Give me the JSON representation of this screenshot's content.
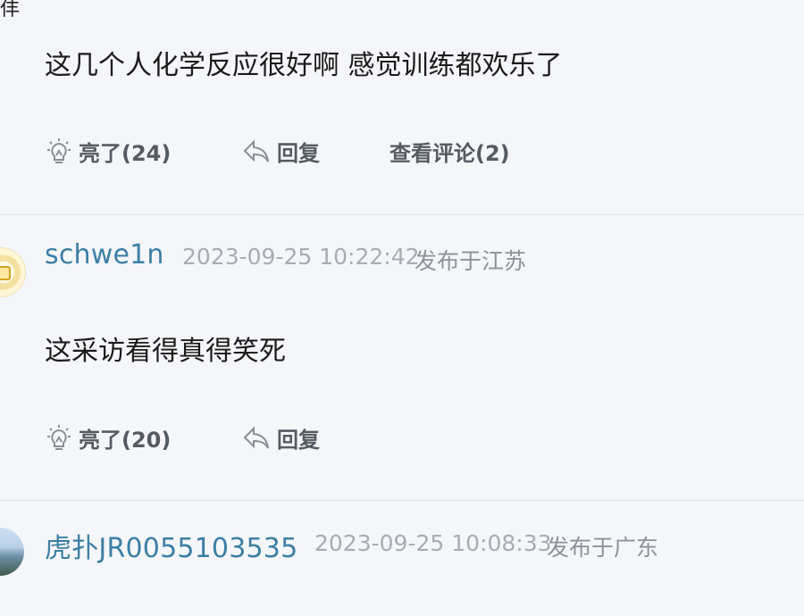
{
  "comments": [
    {
      "text": "这几个人化学反应很好啊 感觉训练都欢乐了",
      "light_label": "亮了(24)",
      "reply_label": "回复",
      "view_comments_label": "查看评论(2)"
    },
    {
      "username": "schwe1n",
      "time": "2023-09-25 10:22:42",
      "location": "发布于江苏",
      "text": "这采访看得真得笑死",
      "light_label": "亮了(20)",
      "reply_label": "回复"
    },
    {
      "username": "虎扑JR0055103535",
      "time": "2023-09-25 10:08:33",
      "location": "发布于广东"
    }
  ],
  "icons": {
    "light": "lightbulb-icon",
    "reply": "reply-arrow-icon"
  },
  "colors": {
    "background": "#f5f6f9",
    "username": "#3c7fa6",
    "time": "#a7acb4",
    "action": "#555b63"
  }
}
